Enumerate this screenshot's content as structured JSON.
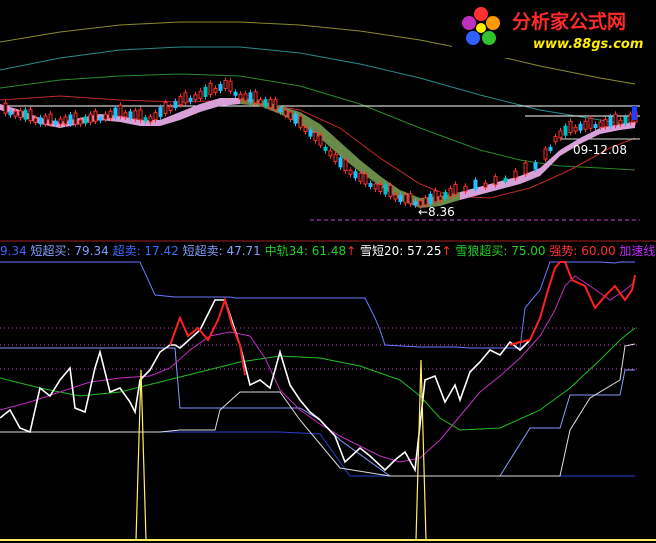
{
  "logo": {
    "name": "分析家公式网",
    "url": "www.88gs.com",
    "colors": {
      "name": "#ff2a2a",
      "url": "#ffee00"
    }
  },
  "chart_data": [
    {
      "type": "candlestick",
      "annotations": {
        "low_marker": "←8.36",
        "range_label": "09-12.08"
      },
      "reference_lines": [
        {
          "name": "resistance",
          "color": "#ffffff",
          "style": "solid"
        },
        {
          "name": "high-level",
          "color": "#ffffff",
          "style": "solid"
        },
        {
          "name": "low-level",
          "color": "#d040d0",
          "style": "dashed"
        }
      ],
      "grid": false
    },
    {
      "type": "line",
      "legend_placement": "top-left",
      "legend": [
        {
          "text": "9.34",
          "color": "#4060ff"
        },
        {
          "text": "短超买: 79.34",
          "color": "#7fa0ff"
        },
        {
          "text": "超卖: 17.42",
          "color": "#3b6cff"
        },
        {
          "text": "短超卖: 47.71",
          "color": "#7fa0ff"
        },
        {
          "text": "中轨34: 61.48",
          "color": "#20d020",
          "arrow": "↑",
          "arrow_color": "#ff3030"
        },
        {
          "text": "雪短20: 57.25",
          "color": "#ffffff",
          "arrow": "↑",
          "arrow_color": "#ff3030"
        },
        {
          "text": "雪狼超买: 75.00",
          "color": "#20d020"
        },
        {
          "text": "强势: 60.00",
          "color": "#ff3030"
        },
        {
          "text": "加速线",
          "color": "#c030ff"
        }
      ],
      "series": [
        {
          "name": "短超买",
          "values": []
        },
        {
          "name": "超卖",
          "values": []
        },
        {
          "name": "短超卖",
          "values": []
        },
        {
          "name": "中轨34",
          "values": []
        },
        {
          "name": "雪短20",
          "values": []
        },
        {
          "name": "雪狼超买",
          "values": []
        },
        {
          "name": "强势",
          "values": []
        },
        {
          "name": "加速线",
          "values": []
        }
      ],
      "reference_lines": [
        {
          "name": "dotted-upper",
          "color": "#c040c0",
          "style": "dotted"
        },
        {
          "name": "dotted-middle",
          "color": "#c040c0",
          "style": "dotted"
        },
        {
          "name": "dotted-lower",
          "color": "#c040c0",
          "style": "dotted"
        }
      ],
      "grid": false
    }
  ]
}
